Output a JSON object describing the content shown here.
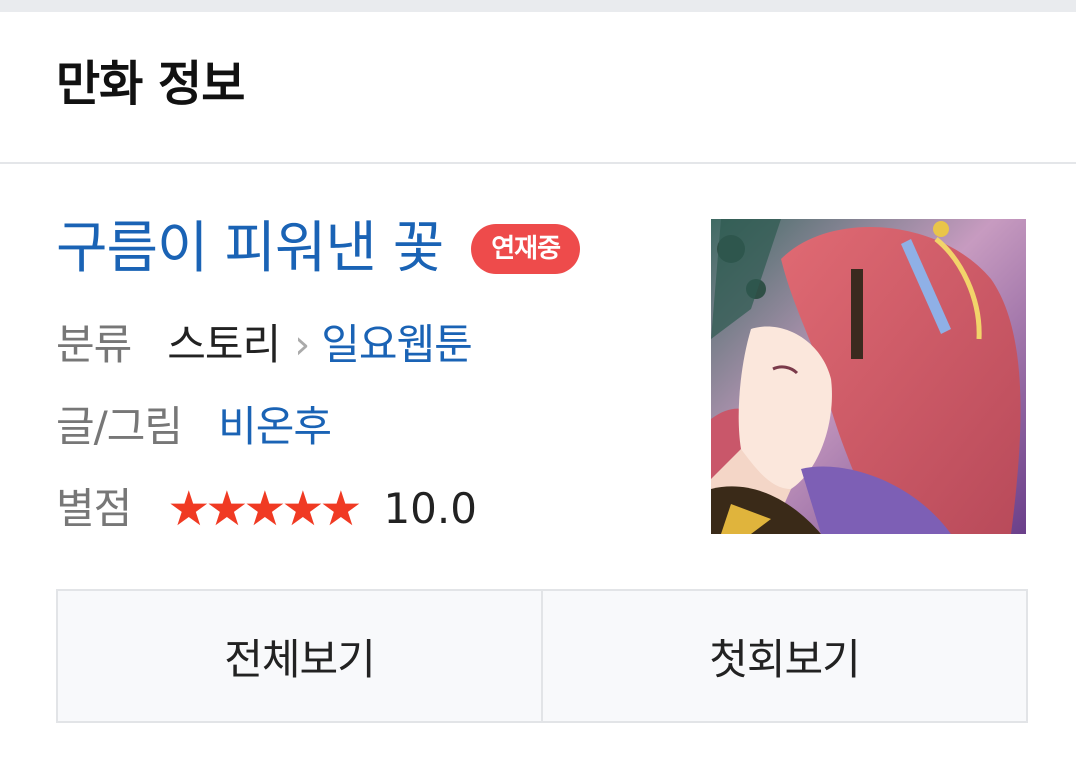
{
  "header": {
    "title": "만화 정보"
  },
  "comic": {
    "title": "구름이 피워낸 꽃",
    "status_badge": "연재중",
    "genre_label": "분류",
    "genre_category": "스토리",
    "genre_chevron": "›",
    "genre_subcategory": "일요웹툰",
    "author_label": "글/그림",
    "author": "비온후",
    "rating_label": "별점",
    "rating_stars": 5,
    "rating_value": "10.0"
  },
  "actions": {
    "view_all_label": "전체보기",
    "first_episode_label": "첫회보기"
  },
  "colors": {
    "link": "#1a63b5",
    "badge": "#ee4b4b",
    "star": "#f03a23"
  }
}
